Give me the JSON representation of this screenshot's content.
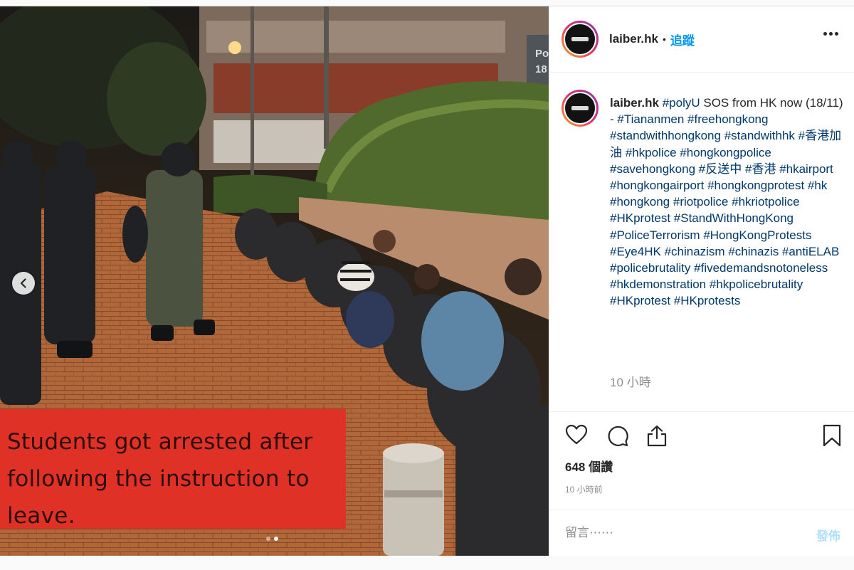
{
  "media": {
    "caption_overlay": "Students got arrested after\nfollowing the instruction to\nleave.",
    "sign_text": "Po\n18",
    "carousel": {
      "total": 2,
      "active": 2
    }
  },
  "header": {
    "username": "laiber.hk",
    "separator": "•",
    "follow_label": "追蹤"
  },
  "caption": {
    "username": "laiber.hk",
    "hashtag_first": "#polyU",
    "text_lead": "SOS from HK now (18/11) -",
    "hashtags": [
      "#Tiananmen",
      "#freehongkong",
      "#standwithhongkong",
      "#standwithhk",
      "#香港加油",
      "#hkpolice",
      "#hongkongpolice",
      "#savehongkong",
      "#反送中",
      "#香港",
      "#hkairport",
      "#hongkongairport",
      "#hongkongprotest",
      "#hk",
      "#hongkong",
      "#riotpolice",
      "#hkriotpolice",
      "#HKprotest",
      "#StandWithHongKong",
      "#PoliceTerrorism",
      "#HongKongProtests",
      "#Eye4HK",
      "#chinazism",
      "#chinazis",
      "#antiELAB",
      "#policebrutality",
      "#fivedemandsnotoneless",
      "#hkdemonstration",
      "#hkpolicebrutality",
      "#HKprotest",
      "#HKprotests"
    ],
    "time": "10 小時"
  },
  "actions": {
    "icons": [
      "heart-icon",
      "comment-icon",
      "share-icon",
      "bookmark-icon"
    ],
    "likes": "648 個讚",
    "posted_ago": "10 小時前"
  },
  "comment_box": {
    "placeholder": "留言⋯⋯",
    "post_label": "發佈"
  }
}
